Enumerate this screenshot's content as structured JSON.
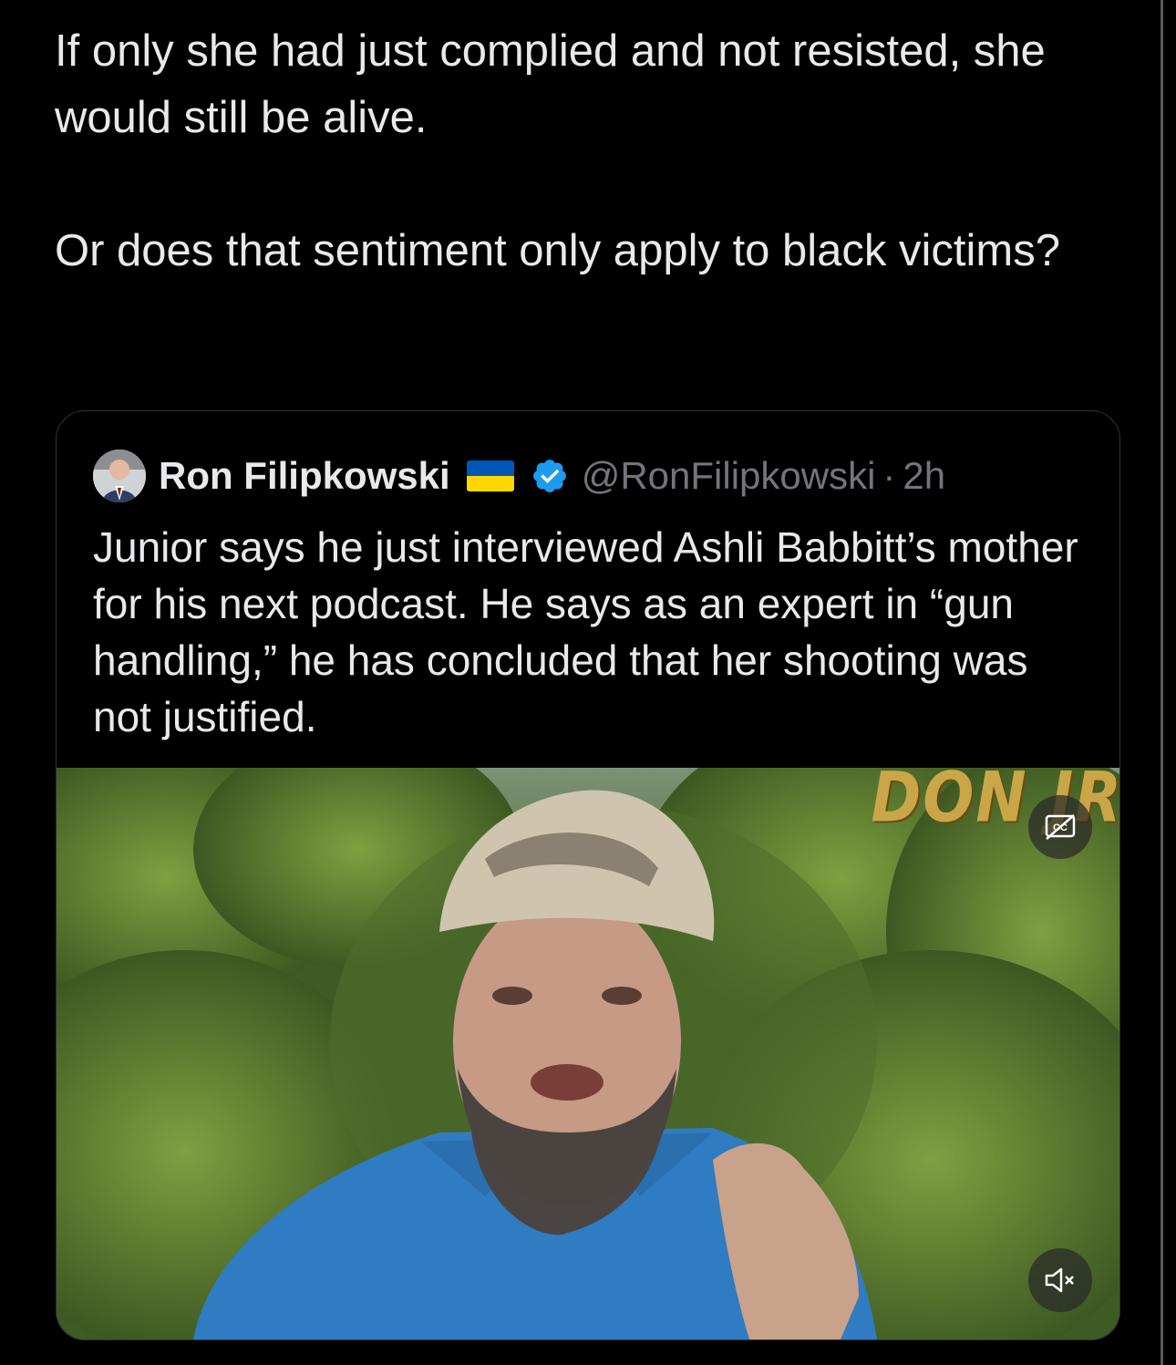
{
  "post": {
    "paragraph_1": "If only she had just complied and not resisted, she would still be alive.",
    "paragraph_2": "Or does that sentiment only apply to black victims?"
  },
  "quoted_post": {
    "author_name": "Ron Filipkowski",
    "flag_emoji": "ukraine-flag",
    "verified_badge": "verified-badge-icon",
    "handle": "@RonFilipkowski",
    "separator": "·",
    "time": "2h",
    "text": "Junior says he just interviewed Ashli Babbitt’s mother for his next podcast. He says as an expert in “gun handling,” he has concluded that her shooting was not justified.",
    "media": {
      "type": "video",
      "watermark": "DON JR",
      "cc_icon": "closed-captions-icon",
      "mute_icon": "muted-speaker-icon"
    }
  },
  "colors": {
    "background": "#000000",
    "text": "#e7e9ea",
    "muted_text": "#71767b",
    "verified_blue": "#1d9bf0",
    "flag_blue": "#0057b7",
    "flag_yellow": "#ffd700"
  }
}
